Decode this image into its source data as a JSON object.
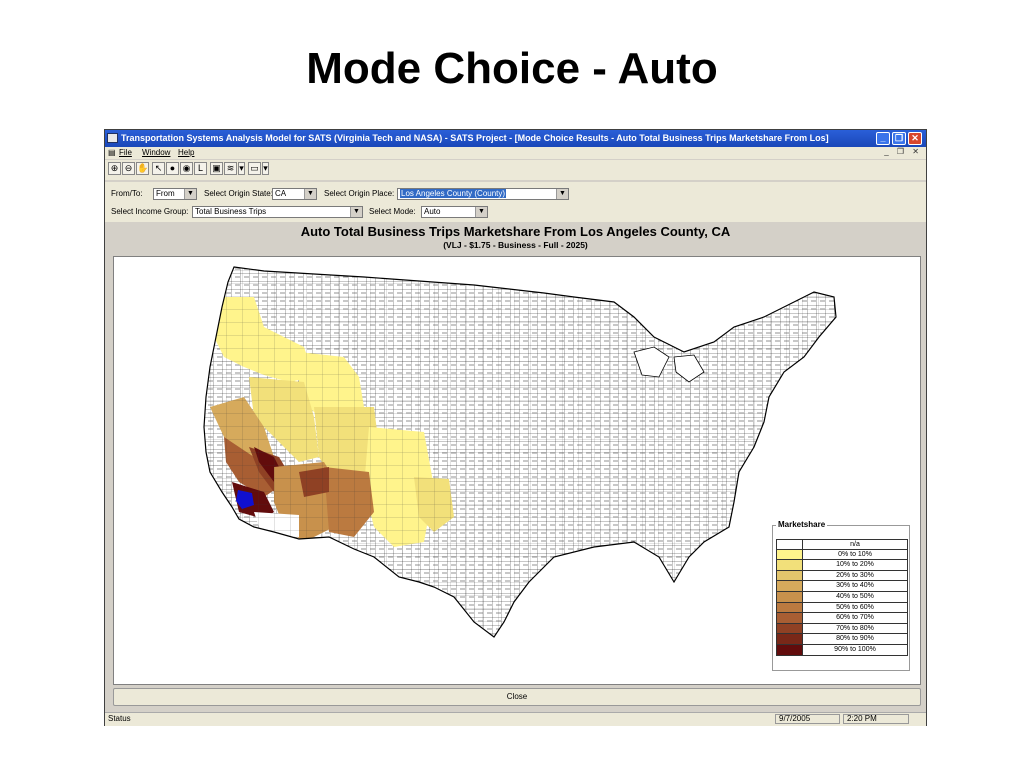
{
  "slide": {
    "title": "Mode Choice - Auto"
  },
  "window": {
    "title": "Transportation Systems Analysis Model for SATS (Virginia Tech and NASA) - SATS Project - [Mode Choice Results - Auto Total Business Trips Marketshare From Los]",
    "buttons": {
      "minimize": "_",
      "restore": "❐",
      "close": "✕"
    }
  },
  "menu": {
    "items": [
      "File",
      "Window",
      "Help"
    ],
    "mdi_controls": "_ ❐ ✕"
  },
  "toolbar": {
    "icons": [
      "zoom-in-icon",
      "zoom-out-icon",
      "pan-hand-icon",
      "select-arrow-icon",
      "info-icon",
      "globe-icon",
      "label-icon",
      "save-icon",
      "layers-icon",
      "dropdown-icon",
      "legend-icon",
      "dropdown-icon"
    ]
  },
  "controls": {
    "from_to": {
      "label": "From/To:",
      "value": "From"
    },
    "origin_state": {
      "label": "Select Origin State:",
      "value": "CA"
    },
    "origin_place": {
      "label": "Select Origin Place:",
      "value": "Los Angeles County (County)"
    },
    "income_group": {
      "label": "Select Income Group:",
      "value": "Total Business Trips"
    },
    "mode": {
      "label": "Select Mode:",
      "value": "Auto"
    }
  },
  "map": {
    "title": "Auto Total Business Trips Marketshare From Los Angeles County, CA",
    "subtitle": "(VLJ - $1.75 - Business - Full - 2025)",
    "origin_color": "#1010d0"
  },
  "legend": {
    "title": "Marketshare",
    "entries": [
      {
        "label": "n/a",
        "color": "#ffffff"
      },
      {
        "label": "0% to 10%",
        "color": "#fff48c"
      },
      {
        "label": "10% to 20%",
        "color": "#f2e07a"
      },
      {
        "label": "20% to 30%",
        "color": "#e3c56c"
      },
      {
        "label": "30% to 40%",
        "color": "#d6aa5c"
      },
      {
        "label": "40% to 50%",
        "color": "#c8914c"
      },
      {
        "label": "50% to 60%",
        "color": "#bb7a40"
      },
      {
        "label": "60% to 70%",
        "color": "#a85e33"
      },
      {
        "label": "70% to 80%",
        "color": "#8f4124"
      },
      {
        "label": "80% to 90%",
        "color": "#792818"
      },
      {
        "label": "90% to 100%",
        "color": "#620c0c"
      }
    ]
  },
  "close_button": "Close",
  "status": {
    "text": "Status",
    "date": "9/7/2005",
    "time": "2:20 PM"
  }
}
